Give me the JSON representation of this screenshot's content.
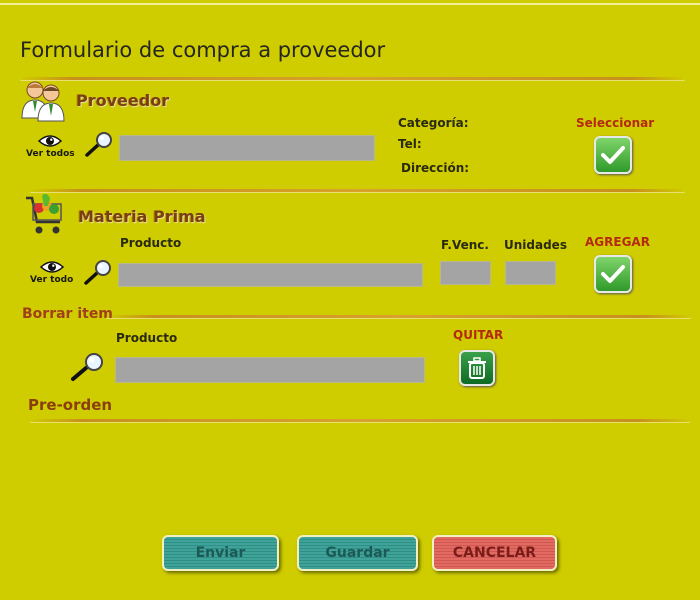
{
  "title": "Formulario de compra a proveedor",
  "proveedor": {
    "heading": "Proveedor",
    "view_all_label": "Ver todos",
    "search_value": "",
    "categoria_label": "Categoría:",
    "tel_label": "Tel:",
    "direccion_label": "Dirección:",
    "select_label": "Seleccionar"
  },
  "materia_prima": {
    "heading": "Materia Prima",
    "producto_label": "Producto",
    "fvenc_label": "F.Venc.",
    "unidades_label": "Unidades",
    "agregar_label": "AGREGAR",
    "view_all_label": "Ver todo",
    "producto_value": "",
    "fvenc_value": "",
    "unidades_value": ""
  },
  "borrar": {
    "heading": "Borrar item",
    "producto_label": "Producto",
    "quitar_label": "QUITAR",
    "producto_value": ""
  },
  "preorden": {
    "heading": "Pre-orden"
  },
  "actions": {
    "enviar": "Enviar",
    "guardar": "Guardar",
    "cancelar": "CANCELAR"
  },
  "colors": {
    "background": "#cfcc00",
    "separator": "#c8901a",
    "accent_red": "#b42a10",
    "button_green": "#3fa39a",
    "button_red": "#e36a63"
  },
  "icons": [
    "users-icon",
    "eye-icon",
    "search-icon",
    "check-icon",
    "shopping-cart-icon",
    "trash-icon"
  ]
}
